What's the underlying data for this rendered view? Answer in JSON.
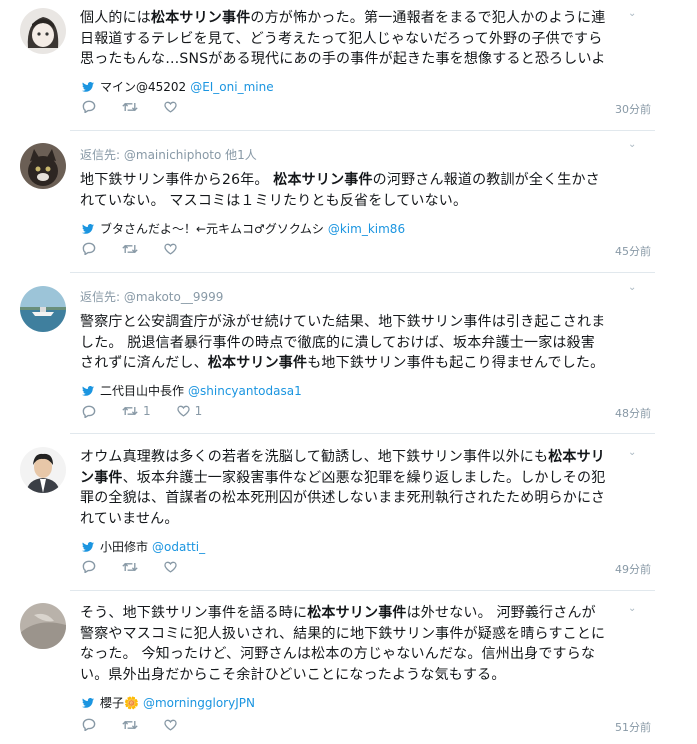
{
  "tweets": [
    {
      "reply_prefix": "",
      "reply_handle": "",
      "reply_suffix": "",
      "lines": [
        [
          {
            "t": "個人的には",
            "b": false
          },
          {
            "t": "松本サリン事件",
            "b": true
          },
          {
            "t": "の方が怖かった。第一通報者をまるで犯人かのように連",
            "b": false
          }
        ],
        [
          {
            "t": "日報道するテレビを見て、どう考えたって犯人じゃないだろって外野の子供ですら",
            "b": false
          }
        ],
        [
          {
            "t": "思ったもんな…SNSがある現代にあの手の事件が起きた事を想像すると恐ろしいよ",
            "b": false
          }
        ]
      ],
      "source_name": "マイン@45202",
      "source_handle": "@EI_oni_mine",
      "retweets": "",
      "likes": "",
      "time": "30分前"
    },
    {
      "reply_prefix": "返信先:",
      "reply_handle": "@mainichiphoto",
      "reply_suffix": "他1人",
      "lines": [
        [
          {
            "t": "地下鉄サリン事件から26年。 ",
            "b": false
          },
          {
            "t": "松本サリン事件",
            "b": true
          },
          {
            "t": "の河野さん報道の教訓が全く生かさ",
            "b": false
          }
        ],
        [
          {
            "t": "れていない。 マスコミは１ミリたりとも反省をしていない。",
            "b": false
          }
        ]
      ],
      "source_name": "ブタさんだよ～！←元キムコ♂グソクムシ",
      "source_handle": "@kim_kim86",
      "retweets": "",
      "likes": "",
      "time": "45分前"
    },
    {
      "reply_prefix": "返信先:",
      "reply_handle": "@makoto__9999",
      "reply_suffix": "",
      "lines": [
        [
          {
            "t": "警察庁と公安調査庁が泳がせ続けていた結果、地下鉄サリン事件は引き起こされま",
            "b": false
          }
        ],
        [
          {
            "t": "した。 脱退信者暴行事件の時点で徹底的に潰しておけば、坂本弁護士一家は殺害",
            "b": false
          }
        ],
        [
          {
            "t": "されずに済んだし、",
            "b": false
          },
          {
            "t": "松本サリン事件",
            "b": true
          },
          {
            "t": "も地下鉄サリン事件も起こり得ませんでした。",
            "b": false
          }
        ]
      ],
      "source_name": "二代目山中長作",
      "source_handle": "@shincyantodasa1",
      "retweets": "1",
      "likes": "1",
      "time": "48分前"
    },
    {
      "reply_prefix": "",
      "reply_handle": "",
      "reply_suffix": "",
      "lines": [
        [
          {
            "t": "オウム真理教は多くの若者を洗脳して勧誘し、地下鉄サリン事件以外にも",
            "b": false
          },
          {
            "t": "松本サリ",
            "b": true
          }
        ],
        [
          {
            "t": "ン事件",
            "b": true
          },
          {
            "t": "、坂本弁護士一家殺害事件など凶悪な犯罪を繰り返しました。しかしその犯",
            "b": false
          }
        ],
        [
          {
            "t": "罪の全貌は、首謀者の松本死刑囚が供述しないまま死刑執行されたため明らかにさ",
            "b": false
          }
        ],
        [
          {
            "t": "れていません。",
            "b": false
          }
        ]
      ],
      "source_name": "小田修市",
      "source_handle": "@odatti_",
      "retweets": "",
      "likes": "",
      "time": "49分前"
    },
    {
      "reply_prefix": "",
      "reply_handle": "",
      "reply_suffix": "",
      "lines": [
        [
          {
            "t": "そう、地下鉄サリン事件を語る時に",
            "b": false
          },
          {
            "t": "松本サリン事件",
            "b": true
          },
          {
            "t": "は外せない。 河野義行さんが",
            "b": false
          }
        ],
        [
          {
            "t": "警察やマスコミに犯人扱いされ、結果的に地下鉄サリン事件が疑惑を晴らすことに",
            "b": false
          }
        ],
        [
          {
            "t": "なった。 今知ったけど、河野さんは松本の方じゃないんだな。信州出身ですらな",
            "b": false
          }
        ],
        [
          {
            "t": "い。県外出身だからこそ余計ひどいことになったような気もする。",
            "b": false
          }
        ]
      ],
      "source_name": "櫻子🌼",
      "source_handle": "@morninggloryJPN",
      "retweets": "",
      "likes": "",
      "time": "51分前"
    }
  ],
  "colors": {
    "accent": "#1b95e0",
    "muted": "#8899a6",
    "text": "#14171a",
    "separator": "#e1e8ed"
  },
  "icons": {
    "source": "twitter-bird-icon",
    "reply": "reply-icon",
    "retweet": "retweet-icon",
    "like": "heart-icon",
    "menu": "chevron-down-icon"
  }
}
